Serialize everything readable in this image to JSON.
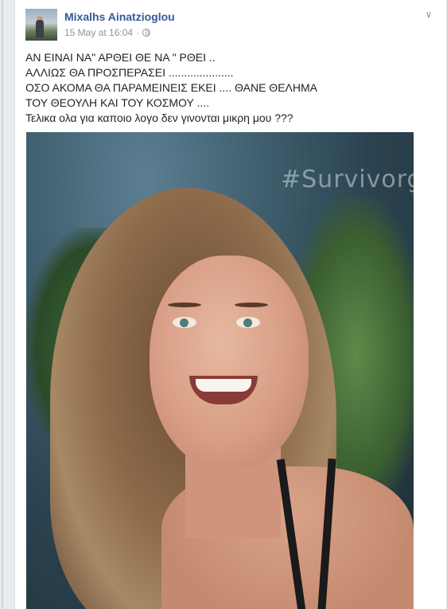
{
  "post": {
    "author": "Mixalhs Ainatzioglou",
    "timestamp": "15 May at 16:04",
    "separator": "·",
    "audience_icon": "globe-icon",
    "menu_icon": "chevron-down-icon",
    "text_lines": [
      "ΑΝ ΕΙΝΑΙ ΝΑ\" ΑΡΘΕΙ ΘΕ ΝΑ \" ΡΘΕΙ ..",
      "ΑΛΛΙΩΣ ΘΑ ΠΡΟΣΠΕΡΑΣΕΙ .....................",
      "ΟΣΟ ΑΚΟΜΑ ΘΑ ΠΑΡΑΜΕΙΝΕΙΣ ΕΚΕΙ .... ΘΑΝΕ ΘΕΛΗΜΑ",
      "ΤΟΥ ΘΕΟΥΛΗ ΚΑΙ ΤΟΥ ΚΟΣΜΟΥ ....",
      "Τελικα ολα για καποιο λογο δεν γινονται μικρη μου ???"
    ],
    "photo_watermark": "#Survivorg"
  }
}
